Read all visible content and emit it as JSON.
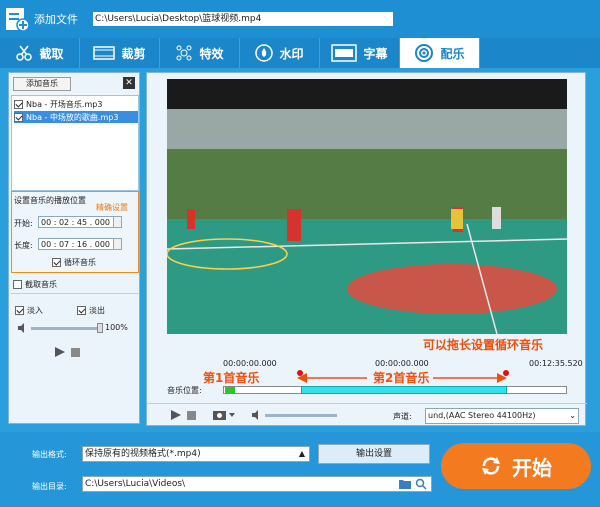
{
  "topbar": {
    "add_file_label": "添加文件",
    "file_path": "C:\\Users\\Lucia\\Desktop\\篮球视频.mp4"
  },
  "tabs": [
    {
      "label": "截取",
      "icon": "scissors-icon"
    },
    {
      "label": "裁剪",
      "icon": "crop-icon"
    },
    {
      "label": "特效",
      "icon": "sparkle-icon"
    },
    {
      "label": "水印",
      "icon": "water-drop-icon"
    },
    {
      "label": "字幕",
      "icon": "subtitle-icon"
    },
    {
      "label": "配乐",
      "icon": "music-disc-icon"
    }
  ],
  "left": {
    "add_music_label": "添加音乐",
    "music_items": [
      "Nba - 开场音乐.mp3",
      "Nba - 中场放的歌曲.mp3"
    ],
    "position_title": "设置音乐的播放位置",
    "precise_label": "精确设置",
    "start_label": "开始:",
    "start_value": "00 : 02 : 45 . 000",
    "length_label": "长度:",
    "length_value": "00 : 07 : 16 . 000",
    "loop_label": "循环音乐",
    "capture_label": "截取音乐",
    "fade_in_label": "淡入",
    "fade_out_label": "淡出",
    "volume_percent": "100%"
  },
  "timeline": {
    "annotation_loop": "可以拖长设置循环音乐",
    "time_start": "00:00:00.000",
    "time_mid": "00:00:00.000",
    "time_end": "00:12:35.520",
    "first_music_label": "第1首音乐",
    "second_music_label": "第2首音乐",
    "music_position_label": "音乐位置:"
  },
  "controls": {
    "channel_label": "声道:",
    "channel_value": "und,(AAC Stereo 44100Hz)"
  },
  "bottom": {
    "output_format_label": "输出格式:",
    "output_format_value": "保持原有的视频格式(*.mp4)",
    "output_settings_label": "输出设置",
    "output_dir_label": "输出目录:",
    "output_dir_value": "C:\\Users\\Lucia\\Videos\\",
    "start_label": "开始"
  }
}
